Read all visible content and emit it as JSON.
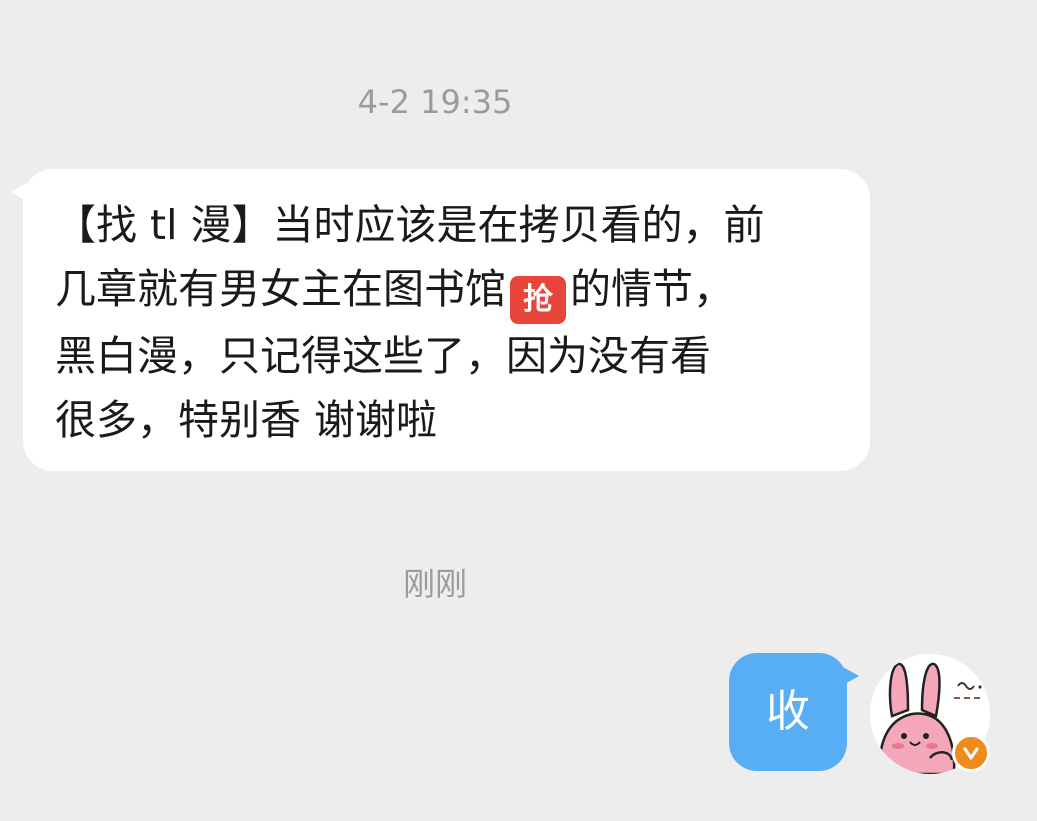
{
  "conversation": {
    "timestamp_1": "4-2 19:35",
    "incoming_message": {
      "line_1": "【找 tl 漫】当时应该是在拷贝看的，前",
      "line_2_before_emoji": "几章就有男女主在图书馆",
      "emoji_label": "抢",
      "emoji_name": "qiang-emoji",
      "line_2_after_emoji": "的情节，",
      "line_3": "黑白漫，只记得这些了，因为没有看",
      "line_4": "很多，特别香 谢谢啦"
    },
    "timestamp_2": "刚刚",
    "outgoing_message": "收"
  },
  "colors": {
    "background": "#ededed",
    "incoming_bubble": "#ffffff",
    "outgoing_bubble": "#58aef5",
    "timestamp": "#9b9b9b",
    "badge": "#f08a1c"
  },
  "icons": {
    "avatar": "pink-rabbit-avatar",
    "badge": "verified-v-badge-icon"
  }
}
